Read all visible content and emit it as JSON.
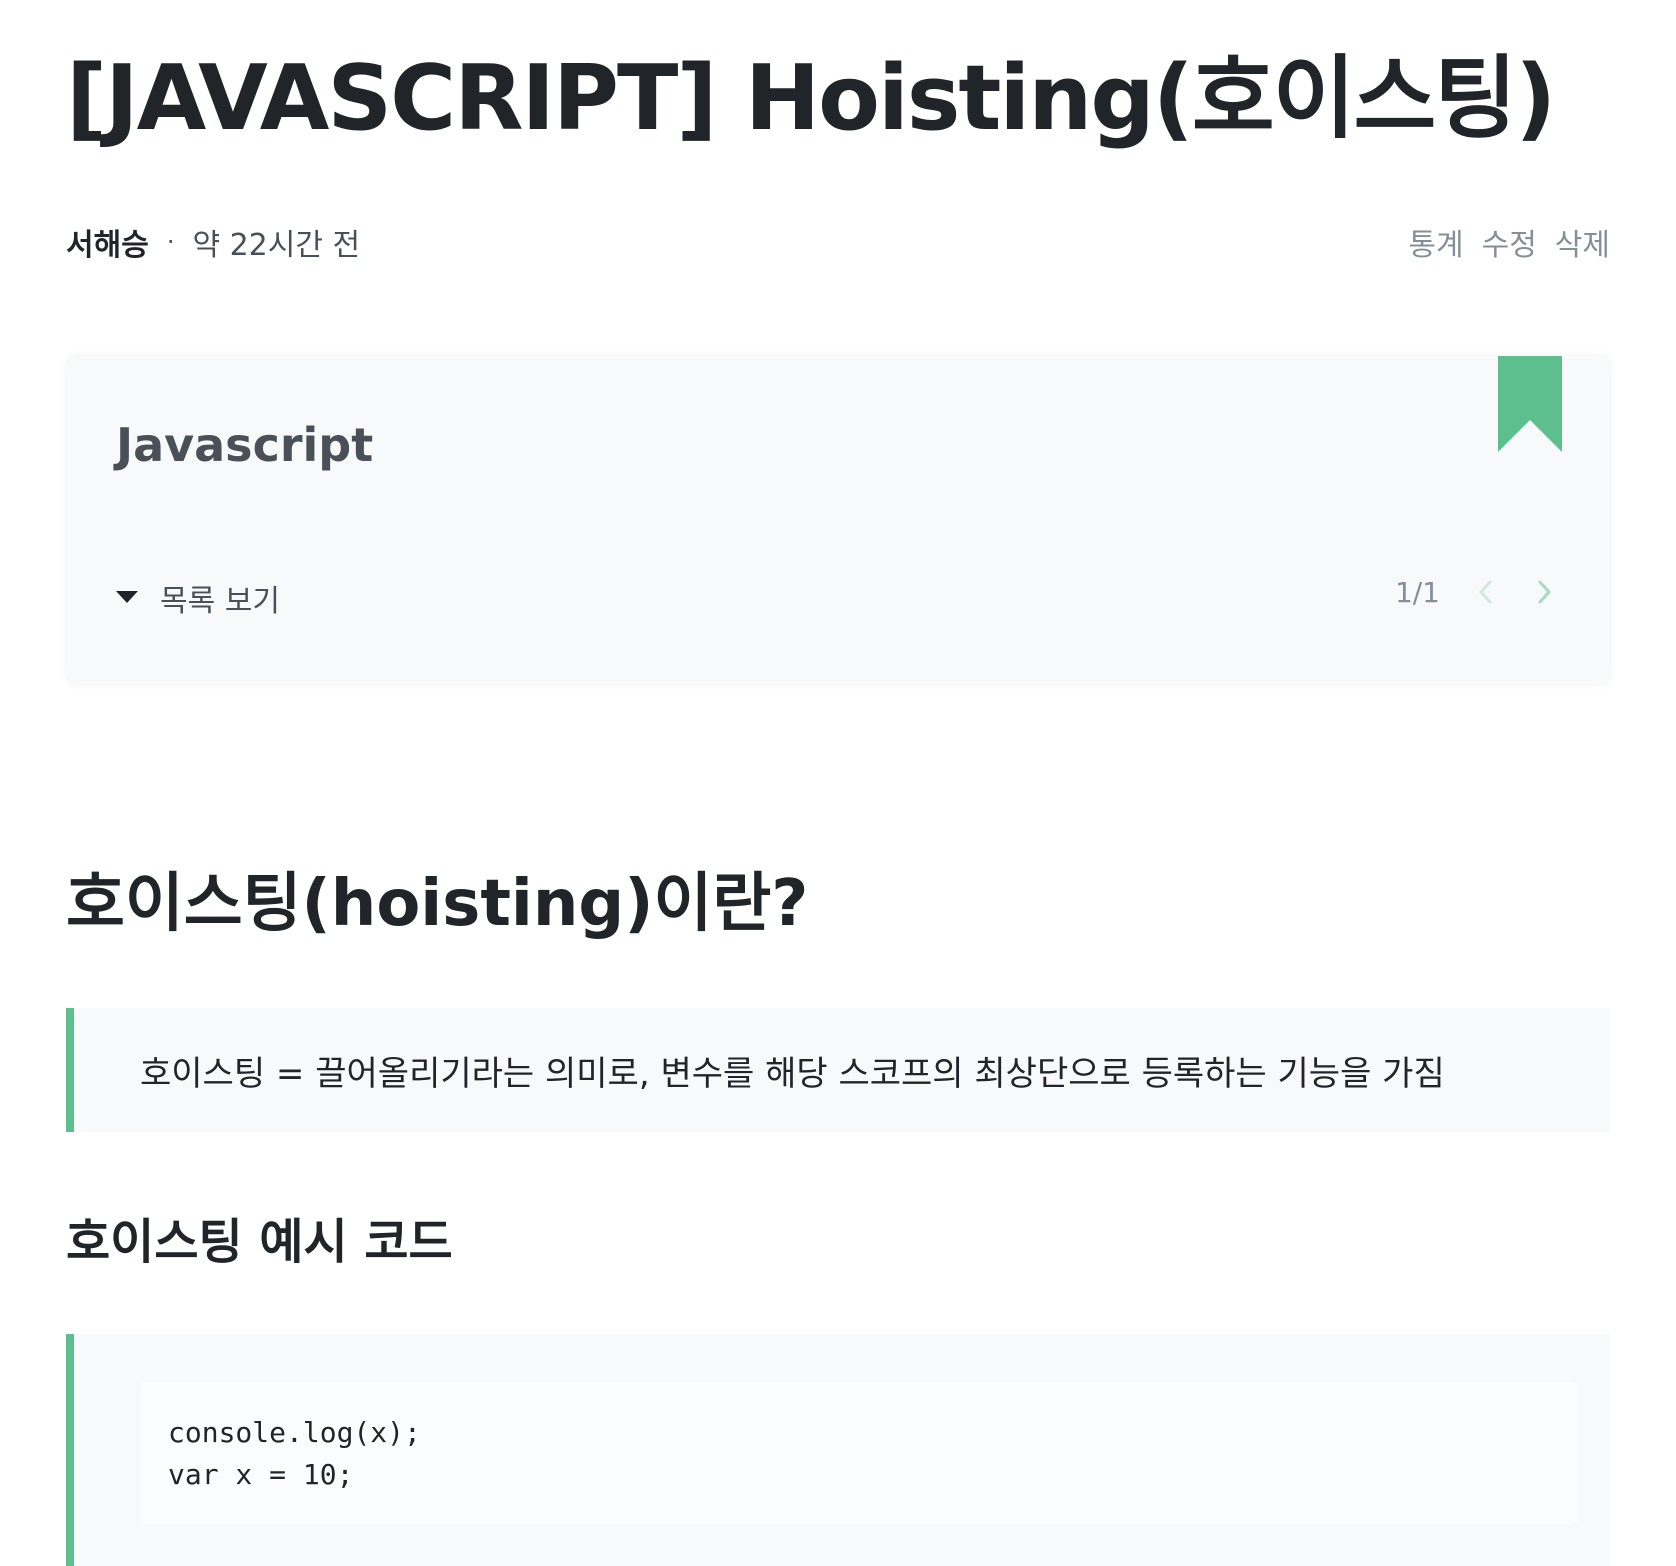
{
  "post": {
    "title": "[JAVASCRIPT] Hoisting(호이스팅)",
    "author": "서해승",
    "separator": "·",
    "time": "약 22시간 전",
    "actions": {
      "stats": "통계",
      "edit": "수정",
      "delete": "삭제"
    }
  },
  "series": {
    "name": "Javascript",
    "toc_label": "목록 보기",
    "page": "1/1",
    "accent_color": "#5ebf8e"
  },
  "content": {
    "heading": "호이스팅(hoisting)이란?",
    "quote": "호이스팅 = 끌어올리기라는 의미로, 변수를 해당 스코프의 최상단으로 등록하는 기능을 가짐",
    "subheading": "호이스팅 예시 코드",
    "code": {
      "line1": "console.log(x);",
      "line2": "var x = 10;"
    }
  }
}
